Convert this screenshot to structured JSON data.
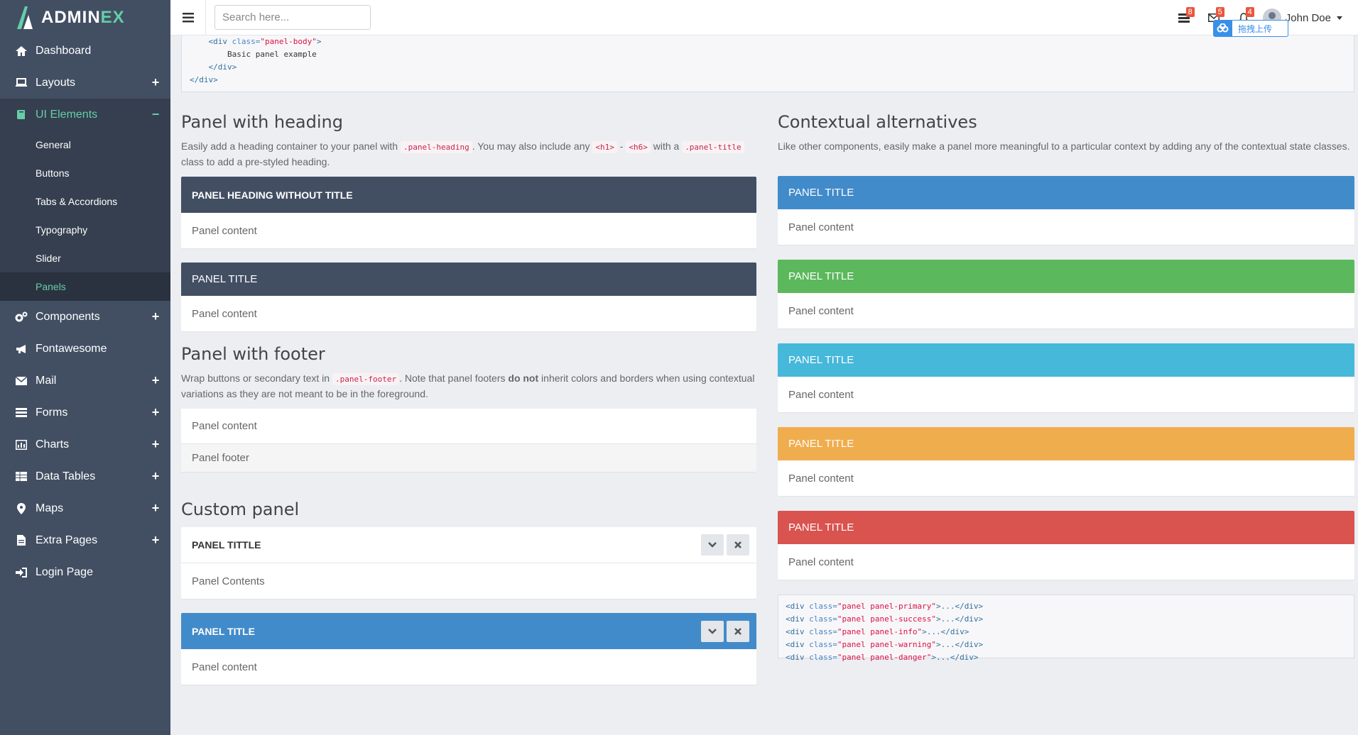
{
  "brand": {
    "name_a": "ADMIN",
    "name_b": "EX"
  },
  "sidebar": {
    "items": [
      {
        "label": "Dashboard",
        "icon": "home-icon"
      },
      {
        "label": "Layouts",
        "icon": "laptop-icon",
        "toggle": "+"
      },
      {
        "label": "UI Elements",
        "icon": "book-icon",
        "toggle": "−"
      },
      {
        "label": "Components",
        "icon": "cogs-icon",
        "toggle": "+"
      },
      {
        "label": "Fontawesome",
        "icon": "bullhorn-icon"
      },
      {
        "label": "Mail",
        "icon": "envelope-icon",
        "toggle": "+"
      },
      {
        "label": "Forms",
        "icon": "tasks-icon",
        "toggle": "+"
      },
      {
        "label": "Charts",
        "icon": "bar-chart-icon",
        "toggle": "+"
      },
      {
        "label": "Data Tables",
        "icon": "table-icon",
        "toggle": "+"
      },
      {
        "label": "Maps",
        "icon": "map-marker-icon",
        "toggle": "+"
      },
      {
        "label": "Extra Pages",
        "icon": "file-icon",
        "toggle": "+"
      },
      {
        "label": "Login Page",
        "icon": "sign-in-icon"
      }
    ],
    "submenu": [
      "General",
      "Buttons",
      "Tabs & Accordions",
      "Typography",
      "Slider",
      "Panels"
    ]
  },
  "header": {
    "search_placeholder": "Search here...",
    "badges": {
      "tasks": "8",
      "mail": "5",
      "notifications": "4"
    },
    "user_name": "John Doe",
    "upload_label": "拖拽上传"
  },
  "code_top": {
    "line1_indent": "    ",
    "line1_open": "<div ",
    "line1_attr": "class=",
    "line1_val": "\"panel-body\"",
    "line1_close": ">",
    "line2": "        Basic panel example",
    "line3": "    </div>",
    "line4": "</div>"
  },
  "heading_section": {
    "title": "Panel with heading",
    "desc_a": "Easily add a heading container to your panel with ",
    "code_a": ".panel-heading",
    "desc_b": ". You may also include any ",
    "code_b": "<h1>",
    "desc_c": " - ",
    "code_c": "<h6>",
    "desc_d": " with a ",
    "code_d": ".panel-title",
    "desc_e": " class to add a pre-styled heading.",
    "panel1_heading": "PANEL HEADING WITHOUT TITLE",
    "panel1_content": "Panel content",
    "panel2_heading": "PANEL TITLE",
    "panel2_content": "Panel content"
  },
  "footer_section": {
    "title": "Panel with footer",
    "desc_a": "Wrap buttons or secondary text in ",
    "code_a": ".panel-footer",
    "desc_b": ". Note that panel footers ",
    "desc_bold": "do not",
    "desc_c": " inherit colors and borders when using contextual variations as they are not meant to be in the foreground.",
    "content": "Panel content",
    "footer": "Panel footer"
  },
  "custom_section": {
    "title": "Custom panel",
    "panel1_heading": "PANEL TITTLE",
    "panel1_content": "Panel Contents",
    "panel2_heading": "PANEL TITLE",
    "panel2_content": "Panel content"
  },
  "contextual_section": {
    "title": "Contextual alternatives",
    "desc": "Like other components, easily make a panel more meaningful to a particular context by adding any of the contextual state classes.",
    "panels": [
      {
        "heading": "PANEL TITLE",
        "content": "Panel content",
        "variant": "primary",
        "color": "#428bca"
      },
      {
        "heading": "PANEL TITLE",
        "content": "Panel content",
        "variant": "success",
        "color": "#5cb85c"
      },
      {
        "heading": "PANEL TITLE",
        "content": "Panel content",
        "variant": "info",
        "color": "#46b8da"
      },
      {
        "heading": "PANEL TITLE",
        "content": "Panel content",
        "variant": "warning",
        "color": "#f0ad4e"
      },
      {
        "heading": "PANEL TITLE",
        "content": "Panel content",
        "variant": "danger",
        "color": "#d9534f"
      }
    ],
    "code_lines": [
      {
        "open": "<div ",
        "attr": "class=",
        "val": "\"panel panel-primary\"",
        "rest": ">...</div>"
      },
      {
        "open": "<div ",
        "attr": "class=",
        "val": "\"panel panel-success\"",
        "rest": ">...</div>"
      },
      {
        "open": "<div ",
        "attr": "class=",
        "val": "\"panel panel-info\"",
        "rest": ">...</div>"
      },
      {
        "open": "<div ",
        "attr": "class=",
        "val": "\"panel panel-warning\"",
        "rest": ">...</div>"
      },
      {
        "open": "<div ",
        "attr": "class=",
        "val": "\"panel panel-danger\"",
        "rest": ">...</div>"
      }
    ]
  },
  "colors": {
    "sidebar_bg": "#424f63",
    "accent": "#65cea7",
    "dark_panel": "#424f63"
  }
}
